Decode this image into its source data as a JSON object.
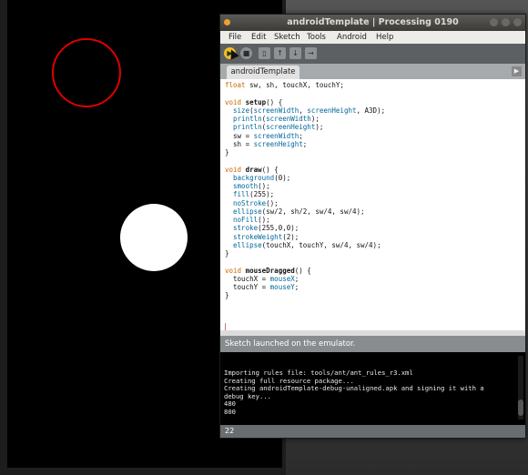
{
  "window": {
    "title": "androidTemplate | Processing 0190"
  },
  "menubar": {
    "items": [
      "File",
      "Edit",
      "Sketch",
      "Tools",
      "Android",
      "Help"
    ]
  },
  "tabs": [
    {
      "label": "androidTemplate"
    }
  ],
  "editor": {
    "lines": [
      "float sw, sh, touchX, touchY;",
      "",
      "void setup() {",
      "  size(screenWidth, screenHeight, A3D);",
      "  println(screenWidth);",
      "  println(screenHeight);",
      "  sw = screenWidth;",
      "  sh = screenHeight;",
      "}",
      "",
      "void draw() {",
      "  background(0);",
      "  smooth();",
      "  fill(255);",
      "  noStroke();",
      "  ellipse(sw/2, sh/2, sw/4, sw/4);",
      "  noFill();",
      "  stroke(255,0,0);",
      "  strokeWeight(2);",
      "  ellipse(touchX, touchY, sw/4, sw/4);",
      "}",
      "",
      "void mouseDragged() {",
      "  touchX = mouseX;",
      "  touchY = mouseY;",
      "}"
    ]
  },
  "status": {
    "message": "Sketch launched on the emulator."
  },
  "console": {
    "lines": [
      "Importing rules file: tools/ant/ant_rules_r3.xml",
      "Creating full resource package...",
      "Creating androidTemplate-debug-unaligned.apk and signing it with a",
      "debug key...",
      "480",
      "800"
    ]
  },
  "line_number": "22",
  "colors": {
    "run_button": "#f0c020",
    "circle_stroke": "#e00000",
    "keyword": "#cc6600",
    "function": "#006699"
  },
  "icons": [
    "run-icon",
    "stop-icon",
    "new-icon",
    "open-icon",
    "save-icon",
    "export-icon",
    "tab-menu-arrow-icon"
  ]
}
